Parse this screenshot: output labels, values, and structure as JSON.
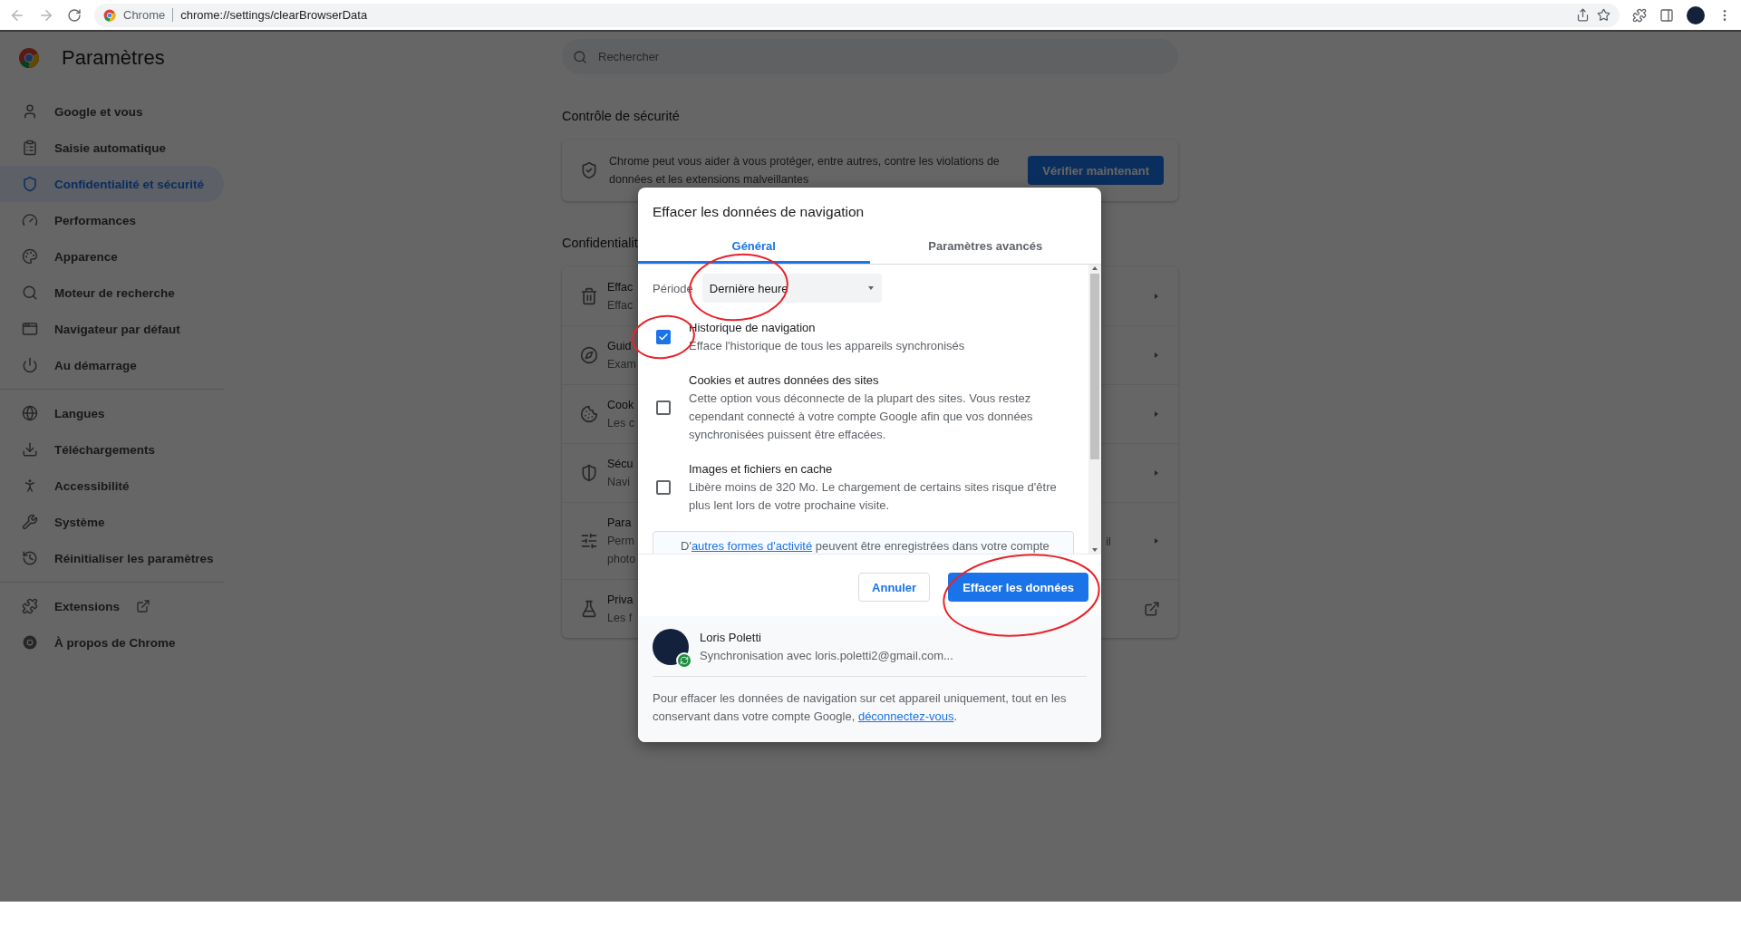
{
  "browser": {
    "site_label": "Chrome",
    "url": "chrome://settings/clearBrowserData"
  },
  "sidebar": {
    "title": "Paramètres",
    "groups": [
      [
        {
          "label": "Google et vous",
          "selected": false,
          "external": false
        },
        {
          "label": "Saisie automatique",
          "selected": false,
          "external": false
        },
        {
          "label": "Confidentialité et sécurité",
          "selected": true,
          "external": false
        },
        {
          "label": "Performances",
          "selected": false,
          "external": false
        },
        {
          "label": "Apparence",
          "selected": false,
          "external": false
        },
        {
          "label": "Moteur de recherche",
          "selected": false,
          "external": false
        },
        {
          "label": "Navigateur par défaut",
          "selected": false,
          "external": false
        },
        {
          "label": "Au démarrage",
          "selected": false,
          "external": false
        }
      ],
      [
        {
          "label": "Langues",
          "selected": false,
          "external": false
        },
        {
          "label": "Téléchargements",
          "selected": false,
          "external": false
        },
        {
          "label": "Accessibilité",
          "selected": false,
          "external": false
        },
        {
          "label": "Système",
          "selected": false,
          "external": false
        },
        {
          "label": "Réinitialiser les paramètres",
          "selected": false,
          "external": false
        }
      ],
      [
        {
          "label": "Extensions",
          "selected": false,
          "external": true
        },
        {
          "label": "À propos de Chrome",
          "selected": false,
          "external": false
        }
      ]
    ]
  },
  "search": {
    "placeholder": "Rechercher"
  },
  "safety_check": {
    "heading": "Contrôle de sécurité",
    "text": "Chrome peut vous aider à vous protéger, entre autres, contre les violations de données et les extensions malveillantes",
    "button": "Vérifier maintenant"
  },
  "privacy": {
    "heading": "Confidentialit",
    "rows": [
      {
        "kind": "arrow",
        "title": "Effac",
        "desc": [
          "Effac"
        ]
      },
      {
        "kind": "arrow",
        "title": "Guid",
        "desc": [
          "Exam"
        ]
      },
      {
        "kind": "arrow",
        "title": "Cook",
        "desc": [
          "Les c"
        ]
      },
      {
        "kind": "arrow",
        "title": "Sécu",
        "desc": [
          "Navi"
        ]
      },
      {
        "kind": "arrow",
        "title": "Para",
        "desc": [
          "Perm",
          "photo"
        ],
        "tail": "il"
      },
      {
        "kind": "external",
        "title": "Priva",
        "desc": [
          "Les f"
        ]
      }
    ]
  },
  "dialog": {
    "title": "Effacer les données de navigation",
    "tabs": [
      {
        "label": "Général",
        "selected": true
      },
      {
        "label": "Paramètres avancés",
        "selected": false
      }
    ],
    "period": {
      "label": "Période",
      "value": "Dernière heure"
    },
    "options": [
      {
        "title": "Historique de navigation",
        "desc": "Efface l'historique de tous les appareils synchronisés",
        "checked": true
      },
      {
        "title": "Cookies et autres données des sites",
        "desc": "Cette option vous déconnecte de la plupart des sites. Vous restez cependant connecté à votre compte Google afin que vos données synchronisées puissent être effacées.",
        "checked": false
      },
      {
        "title": "Images et fichiers en cache",
        "desc": "Libère moins de 320 Mo. Le chargement de certains sites risque d'être plus lent lors de votre prochaine visite.",
        "checked": false
      }
    ],
    "notice": {
      "before": "D'",
      "link": "autres formes d'activité",
      "after": " peuvent être enregistrées dans votre compte"
    },
    "cancel": "Annuler",
    "confirm": "Effacer les données",
    "account": {
      "name": "Loris Poletti",
      "sync": "Synchronisation avec loris.poletti2@gmail.com..."
    },
    "footer": {
      "text": "Pour effacer les données de navigation sur cet appareil uniquement, tout en les conservant dans votre compte Google, ",
      "link": "déconnectez-vous",
      "end": "."
    }
  }
}
